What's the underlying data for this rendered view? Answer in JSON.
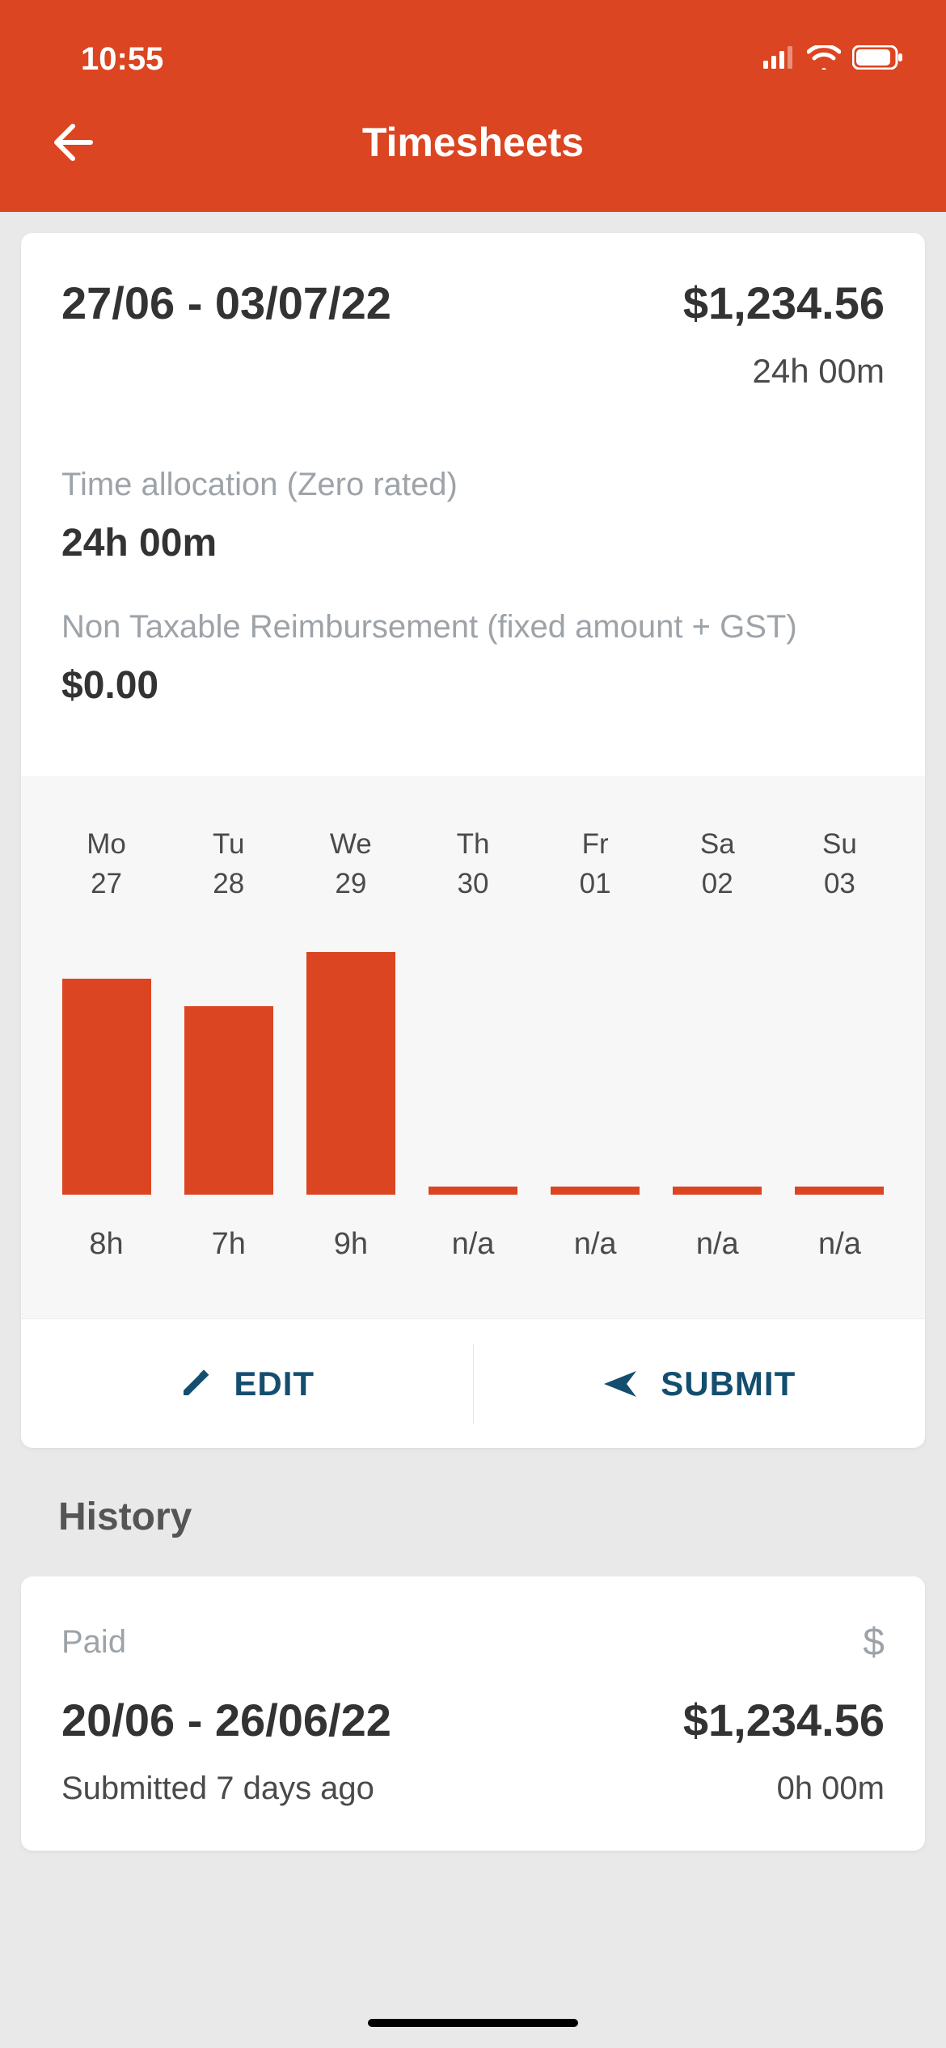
{
  "status": {
    "time": "10:55"
  },
  "nav": {
    "title": "Timesheets"
  },
  "timesheet": {
    "date_range": "27/06 - 03/07/22",
    "amount": "$1,234.56",
    "total_hours": "24h 00m",
    "alloc_label": "Time allocation (Zero rated)",
    "alloc_value": "24h 00m",
    "reimb_label": "Non Taxable Reimbursement (fixed amount + GST)",
    "reimb_value": "$0.00"
  },
  "chart_data": {
    "type": "bar",
    "categories_day": [
      "Mo",
      "Tu",
      "We",
      "Th",
      "Fr",
      "Sa",
      "Su"
    ],
    "categories_date": [
      "27",
      "28",
      "29",
      "30",
      "01",
      "02",
      "03"
    ],
    "value_labels": [
      "8h",
      "7h",
      "9h",
      "n/a",
      "n/a",
      "n/a",
      "n/a"
    ],
    "values": [
      8,
      7,
      9,
      0,
      0,
      0,
      0
    ],
    "ylim": [
      0,
      9
    ],
    "title": "",
    "xlabel": "",
    "ylabel": ""
  },
  "actions": {
    "edit_label": "EDIT",
    "submit_label": "SUBMIT"
  },
  "history": {
    "title": "History",
    "items": [
      {
        "status": "Paid",
        "date_range": "20/06 - 26/06/22",
        "amount": "$1,234.56",
        "submitted": "Submitted 7 days ago",
        "hours": "0h 00m"
      }
    ]
  }
}
